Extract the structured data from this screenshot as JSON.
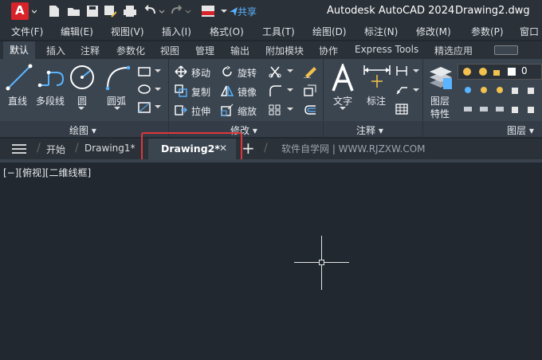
{
  "titlebar": {
    "app_letter": "A",
    "share_label": "共享",
    "app_name": "Autodesk AutoCAD 2024",
    "document": "Drawing2.dwg"
  },
  "menu": [
    "文件(F)",
    "编辑(E)",
    "视图(V)",
    "插入(I)",
    "格式(O)",
    "工具(T)",
    "绘图(D)",
    "标注(N)",
    "修改(M)",
    "参数(P)",
    "窗口"
  ],
  "ribbon_tabs": [
    "默认",
    "插入",
    "注释",
    "参数化",
    "视图",
    "管理",
    "输出",
    "附加模块",
    "协作",
    "Express Tools",
    "精选应用"
  ],
  "ribbon": {
    "draw": {
      "line": "直线",
      "polyline": "多段线",
      "circle": "圆",
      "arc": "圆弧",
      "title": "绘图 ▾"
    },
    "modify": {
      "move": "移动",
      "rotate": "旋转",
      "copy": "复制",
      "mirror": "镜像",
      "stretch": "拉伸",
      "scale": "缩放",
      "title": "修改 ▾"
    },
    "annotation": {
      "text": "文字",
      "dimension": "标注",
      "title": "注释 ▾"
    },
    "layers": {
      "layer_props_1": "图层",
      "layer_props_2": "特性",
      "layer_value": "0",
      "title": "图层 ▾"
    }
  },
  "filetabs": {
    "start": "开始",
    "drawing1": "Drawing1*",
    "drawing2": "Drawing2*",
    "close": "✕",
    "add": "+",
    "watermark": "软件自学网 | WWW.RJZXW.COM"
  },
  "viewport": {
    "label": "[−][俯视][二维线框]"
  }
}
